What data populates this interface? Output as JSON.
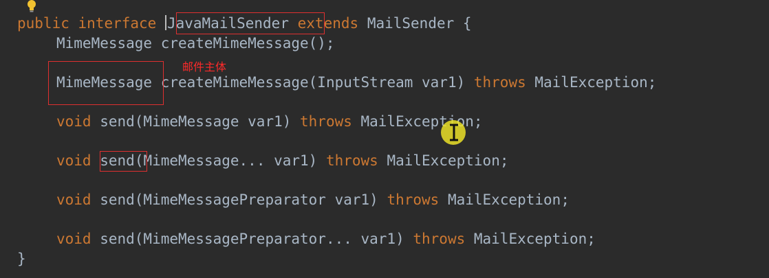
{
  "code": {
    "line1": {
      "kw1": "public",
      "kw2": "interface",
      "name": "JavaMailSender",
      "kw3": "extends",
      "parent": "MailSender {"
    },
    "line2": {
      "text": "MimeMessage createMimeMessage();"
    },
    "line3": {
      "ret": "MimeMessage",
      "rest": " createMimeMessage(InputStream var1) ",
      "throws": "throws",
      "exc": " MailException;"
    },
    "line4": {
      "void": "void",
      "rest": " send(MimeMessage var1) ",
      "throws": "throws",
      "exc": " MailException;"
    },
    "line5": {
      "void": "void",
      "send": "send",
      "rest": "(MimeMessage... var1) ",
      "throws": "throws",
      "exc": " MailException;"
    },
    "line6": {
      "void": "void",
      "rest": " send(MimeMessagePreparator var1) ",
      "throws": "throws",
      "exc": " MailException;"
    },
    "line7": {
      "void": "void",
      "rest": " send(MimeMessagePreparator... var1) ",
      "throws": "throws",
      "exc": " MailException;"
    },
    "line8": {
      "text": "}"
    }
  },
  "annotation": {
    "text": "邮件主体"
  },
  "colors": {
    "keyword": "#cc7832",
    "identifier": "#a9b7c6",
    "background": "#2b2b2b",
    "annotation": "#ff2a2a",
    "box": "#e03030"
  },
  "icons": {
    "bulb": "lightbulb-icon",
    "cursor": "text-cursor-icon"
  }
}
